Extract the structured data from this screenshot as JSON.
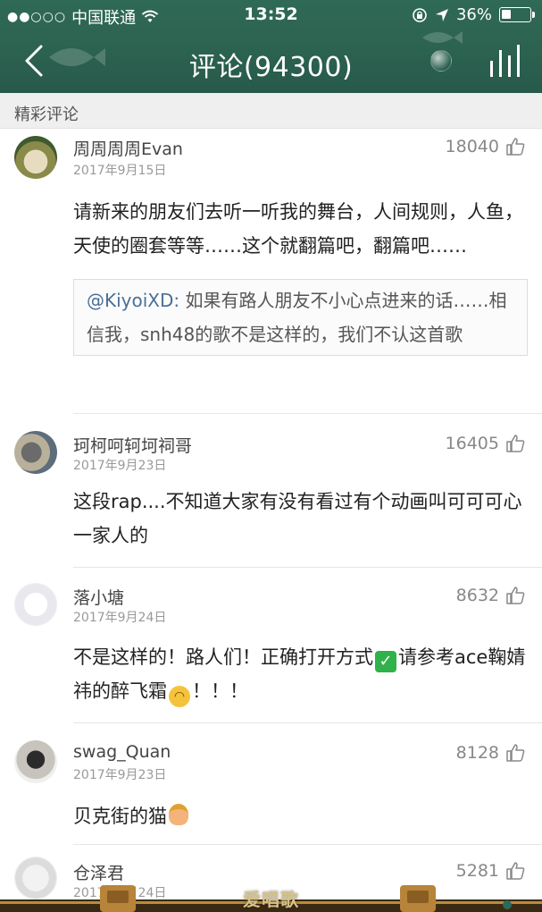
{
  "status_bar": {
    "signal_dots": "●●○○○",
    "carrier": "中国联通",
    "time": "13:52",
    "battery_text": "36%",
    "battery_level": 0.36
  },
  "nav": {
    "title": "评论(94300)",
    "back_icon": "chevron-left-icon",
    "menu_icon": "bars-icon"
  },
  "section": {
    "label": "精彩评论"
  },
  "comments": [
    {
      "username": "周周周周Evan",
      "date": "2017年9月15日",
      "likes": "18040",
      "text": "请新来的朋友们去听一听我的舞台，人间规则，人鱼，天使的圈套等等……这个就翻篇吧，翻篇吧……",
      "reply": {
        "mention": "@KiyoiXD:",
        "text": " 如果有路人朋友不小心点进来的话……相信我，snh48的歌不是这样的，我们不认这首歌"
      }
    },
    {
      "username": "珂柯呵轲坷祠哥",
      "date": "2017年9月23日",
      "likes": "16405",
      "text": "这段rap....不知道大家有没有看过有个动画叫可可可心一家人的"
    },
    {
      "username": "落小塘",
      "date": "2017年9月24日",
      "likes": "8632",
      "text_a": "不是这样的！路人们！正确打开方式",
      "text_b": "请参考ace鞠婧祎的醉飞霜",
      "text_c": "！！！"
    },
    {
      "username": "swag_Quan",
      "date": "2017年9月23日",
      "likes": "8128",
      "text": "贝克街的猫"
    },
    {
      "username": "仓泽君",
      "date": "2017年9月24日",
      "likes": "5281"
    }
  ],
  "watermark": "爱唱歌",
  "colors": {
    "header": "#2c6250",
    "section_bg": "#efefef",
    "mention": "#4a6f97"
  }
}
